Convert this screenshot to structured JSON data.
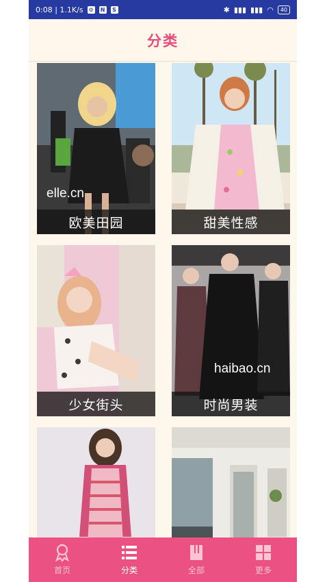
{
  "status": {
    "time_rate": "0:08 | 1.1K/s",
    "battery": "40"
  },
  "header": {
    "title": "分类"
  },
  "categories": [
    {
      "label": "欧美田园",
      "brand": "elle.cn"
    },
    {
      "label": "甜美性感"
    },
    {
      "label": "少女街头"
    },
    {
      "label": "时尚男装",
      "brand": "haibao.cn"
    },
    {
      "label": ""
    },
    {
      "label": ""
    }
  ],
  "nav": [
    {
      "label": "首页",
      "icon": "ribbon-icon"
    },
    {
      "label": "分类",
      "icon": "list-icon"
    },
    {
      "label": "全部",
      "icon": "book-icon"
    },
    {
      "label": "更多",
      "icon": "grid-icon"
    }
  ],
  "colors": {
    "accent": "#ec5184",
    "title": "#e84a7a",
    "status_bar": "#263aa2"
  }
}
